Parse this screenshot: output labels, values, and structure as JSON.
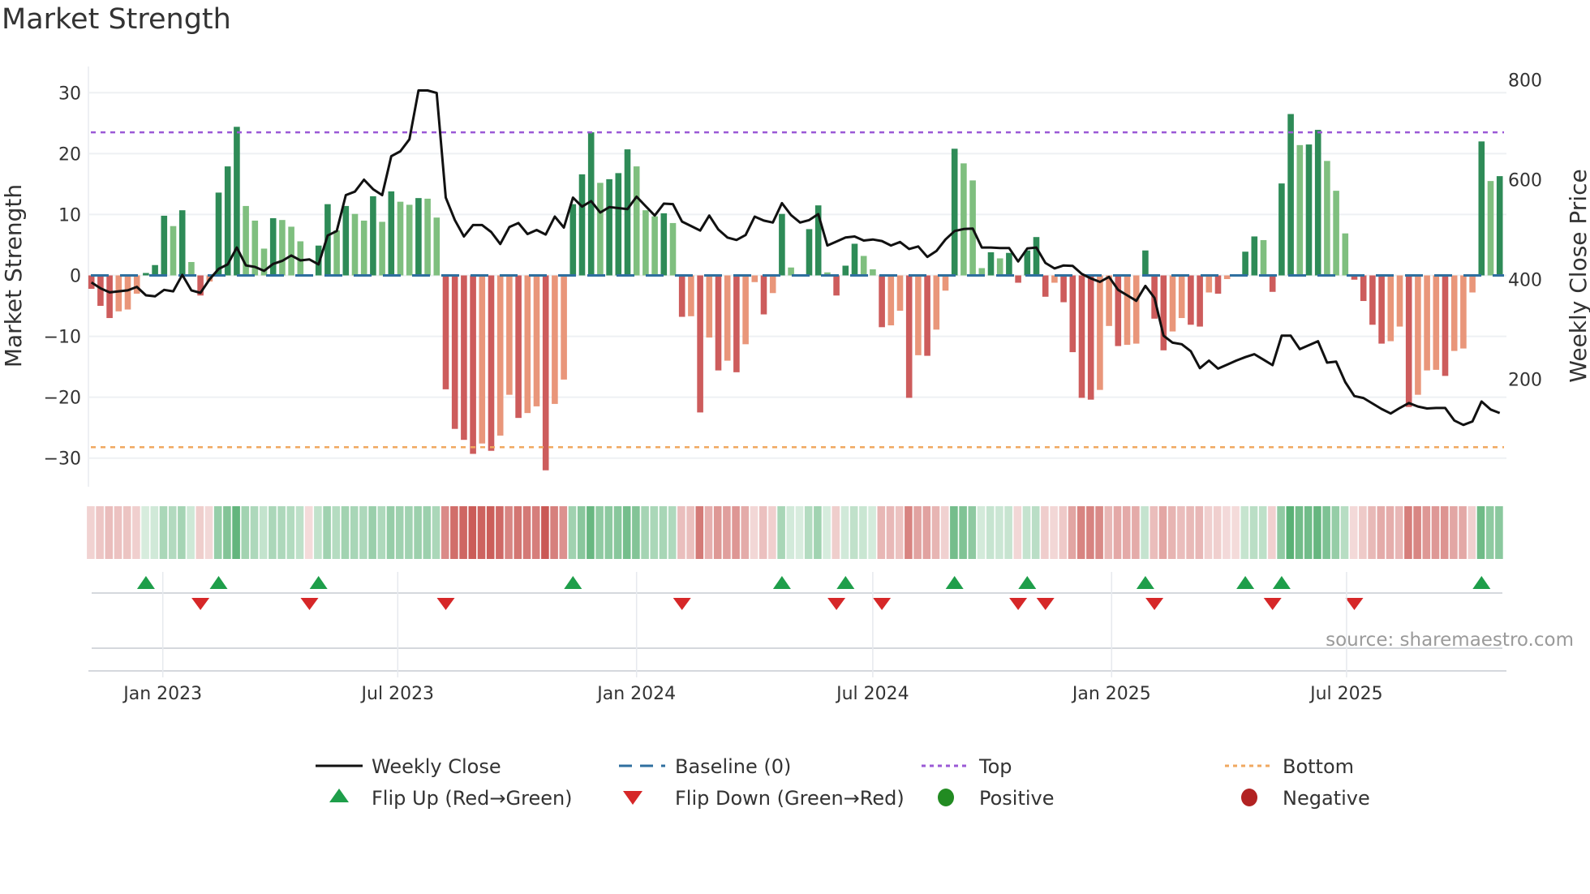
{
  "title": "Market Strength",
  "source": "source: sharemaestro.com",
  "legend": {
    "weekly_close": "Weekly Close",
    "baseline": "Baseline (0)",
    "top": "Top",
    "bottom": "Bottom",
    "flip_up": "Flip Up (Red→Green)",
    "flip_down": "Flip Down (Green→Red)",
    "positive": "Positive",
    "negative": "Negative"
  },
  "colors": {
    "positive_strong": "#2e8b57",
    "positive_weak": "#7fbf7f",
    "negative_strong": "#cd5c5c",
    "negative_weak": "#e9967a",
    "line": "#111111",
    "baseline": "#2f6f9f",
    "top": "#9b59d6",
    "bottom": "#f0a860",
    "flip_up": "#1e9e4a",
    "flip_down": "#d62728",
    "positive_dot": "#228b22",
    "negative_dot": "#b22222"
  },
  "chart_data": {
    "type": "bar",
    "title": "Market Strength",
    "ylabel": "Market Strength",
    "y2label": "Weekly Close Price",
    "ylim": [
      -34.7,
      34.3
    ],
    "y2lim": [
      -16,
      827
    ],
    "yticks": [
      30,
      20,
      10,
      0,
      -10,
      -20,
      -30
    ],
    "y2ticks": [
      800,
      600,
      400,
      200
    ],
    "ytick_labels": [
      "30",
      "20",
      "10",
      "0",
      "−10",
      "−20",
      "−30"
    ],
    "y2tick_labels": [
      "800",
      "600",
      "400",
      "200"
    ],
    "start_date": "2022-11-07",
    "frequency_days": 7,
    "xticks": [
      {
        "date": "2023-01-01",
        "label": "Jan 2023"
      },
      {
        "date": "2023-07-01",
        "label": "Jul 2023"
      },
      {
        "date": "2024-01-01",
        "label": "Jan 2024"
      },
      {
        "date": "2024-07-01",
        "label": "Jul 2024"
      },
      {
        "date": "2025-01-01",
        "label": "Jan 2025"
      },
      {
        "date": "2025-07-01",
        "label": "Jul 2025"
      }
    ],
    "top_level": 23.5,
    "bottom_level": -28.2,
    "baseline": 0,
    "strength": [
      -2.2,
      -5.0,
      -7.0,
      -5.9,
      -5.6,
      -3.0,
      0.4,
      1.7,
      9.8,
      8.1,
      10.7,
      2.2,
      -3.3,
      -1.0,
      13.6,
      17.9,
      24.4,
      11.4,
      9.0,
      4.4,
      9.4,
      9.1,
      8.0,
      5.6,
      -0.2,
      4.9,
      11.7,
      7.4,
      11.4,
      10.1,
      9.0,
      13.0,
      8.8,
      13.8,
      12.1,
      11.6,
      12.7,
      12.6,
      9.5,
      -18.7,
      -25.2,
      -27.0,
      -29.3,
      -27.6,
      -28.8,
      -26.3,
      -19.6,
      -23.4,
      -22.6,
      -21.5,
      -32.0,
      -21.1,
      -17.1,
      11.7,
      16.6,
      23.5,
      15.2,
      15.8,
      16.8,
      20.7,
      17.9,
      10.7,
      9.7,
      10.2,
      8.6,
      -6.8,
      -6.7,
      -22.5,
      -10.2,
      -15.6,
      -14.0,
      -15.9,
      -11.3,
      -1.1,
      -6.4,
      -2.9,
      10.1,
      1.3,
      0.2,
      7.6,
      11.5,
      0.5,
      -3.3,
      1.6,
      5.2,
      3.2,
      1.0,
      -8.5,
      -8.2,
      -5.8,
      -20.1,
      -13.1,
      -13.2,
      -8.9,
      -2.5,
      20.8,
      18.4,
      15.6,
      1.2,
      3.8,
      2.8,
      3.7,
      -1.2,
      4.1,
      6.3,
      -3.5,
      -1.2,
      -4.4,
      -12.6,
      -20.1,
      -20.4,
      -18.8,
      -8.3,
      -11.6,
      -11.4,
      -11.2,
      4.1,
      -7.1,
      -12.3,
      -9.2,
      -7.0,
      -8.1,
      -8.4,
      -2.8,
      -3.0,
      -0.6,
      -0.2,
      3.9,
      6.4,
      5.8,
      -2.7,
      15.1,
      26.5,
      21.4,
      21.5,
      23.9,
      18.8,
      13.9,
      6.9,
      -0.7,
      -4.2,
      -8.1,
      -11.2,
      -10.8,
      -8.4,
      -21.6,
      -19.6,
      -15.6,
      -15.5,
      -16.5,
      -12.4,
      -12.0,
      -2.8,
      22.0,
      15.5,
      16.3
    ],
    "weekly_close": [
      394,
      382,
      374,
      376,
      378,
      385,
      368,
      366,
      379,
      376,
      409,
      378,
      373,
      400,
      421,
      430,
      464,
      428,
      425,
      417,
      431,
      437,
      448,
      438,
      440,
      430,
      488,
      497,
      569,
      576,
      600,
      581,
      569,
      647,
      657,
      681,
      779,
      779,
      774,
      564,
      519,
      486,
      509,
      509,
      495,
      471,
      505,
      513,
      491,
      499,
      490,
      526,
      504,
      564,
      546,
      557,
      534,
      545,
      543,
      541,
      566,
      547,
      528,
      552,
      551,
      516,
      507,
      498,
      528,
      500,
      484,
      479,
      489,
      526,
      518,
      514,
      553,
      529,
      514,
      519,
      531,
      468,
      476,
      484,
      486,
      478,
      480,
      477,
      468,
      475,
      461,
      466,
      445,
      457,
      480,
      497,
      501,
      502,
      464,
      464,
      463,
      463,
      436,
      462,
      464,
      433,
      422,
      428,
      427,
      411,
      402,
      395,
      405,
      379,
      368,
      357,
      387,
      363,
      287,
      273,
      270,
      256,
      222,
      237,
      221,
      229,
      237,
      244,
      250,
      239,
      228,
      287,
      287,
      260,
      268,
      276,
      233,
      235,
      194,
      166,
      162,
      151,
      140,
      131,
      142,
      152,
      145,
      141,
      142,
      142,
      117,
      108,
      115,
      155,
      139,
      132
    ],
    "flip_up_weeks": [
      7,
      15,
      26,
      54,
      77,
      84,
      96,
      104,
      117,
      128,
      132,
      154
    ],
    "flip_down_weeks": [
      13,
      25,
      40,
      66,
      83,
      88,
      103,
      106,
      118,
      131,
      140
    ],
    "legend_position": "bottom"
  }
}
